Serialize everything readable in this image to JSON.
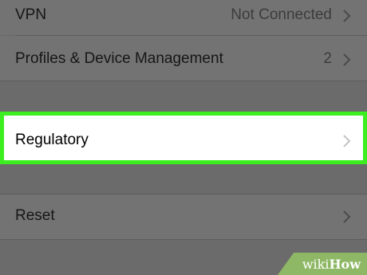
{
  "rows": {
    "vpn": {
      "label": "VPN",
      "value": "Not Connected"
    },
    "profiles": {
      "label": "Profiles & Device Management",
      "value": "2"
    },
    "regulatory": {
      "label": "Regulatory"
    },
    "reset": {
      "label": "Reset"
    }
  },
  "watermark": {
    "prefix": "wiki",
    "suffix": "How"
  },
  "colors": {
    "background": "#6b6b6b",
    "highlight_border": "#3cee1f",
    "watermark_bg": "#8eb865"
  }
}
